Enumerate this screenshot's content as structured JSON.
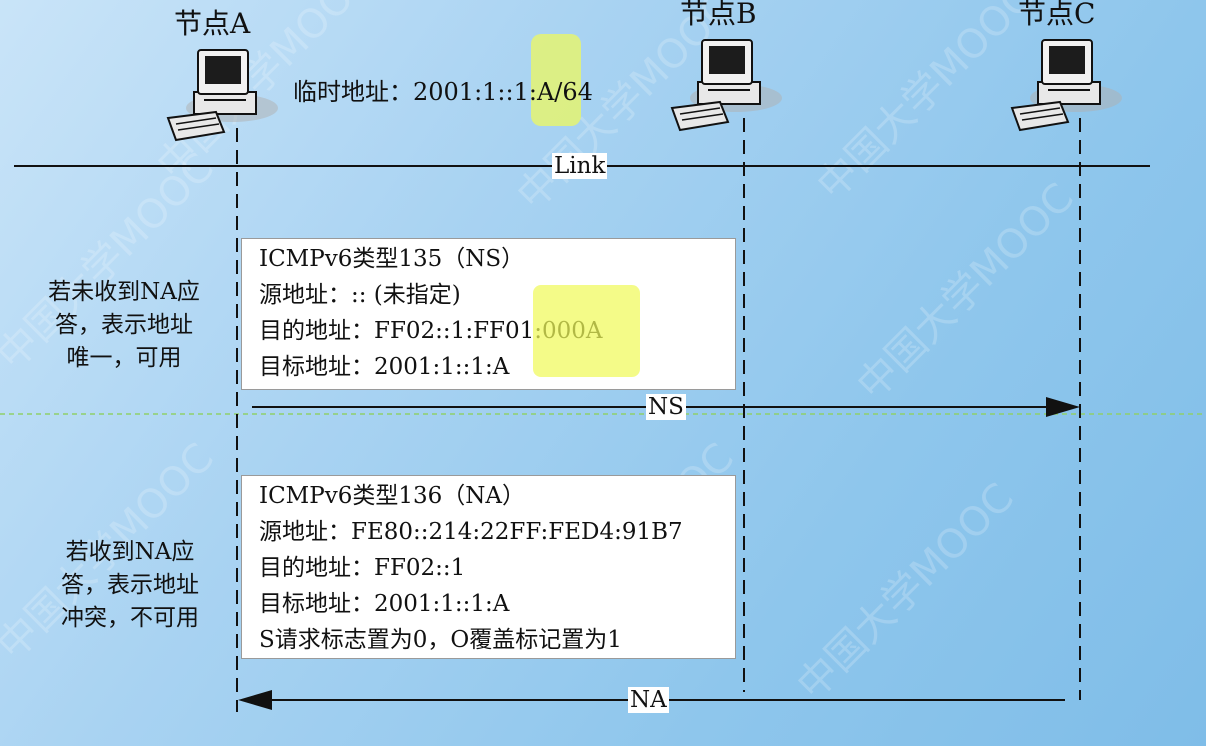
{
  "nodes": [
    {
      "label": "节点A"
    },
    {
      "label": "节点B"
    },
    {
      "label": "节点C"
    }
  ],
  "temp_address": "临时地址：2001:1::1:A/64",
  "link_label": "Link",
  "ns_box": {
    "lines": [
      "ICMPv6类型135（NS）",
      "源地址：:: (未指定)",
      "目的地址：FF02::1:FF01:000A",
      "目标地址：2001:1::1:A"
    ]
  },
  "na_box": {
    "lines": [
      "ICMPv6类型136（NA）",
      "源地址：FE80::214:22FF:FED4:91B7",
      "目的地址：FF02::1",
      "目标地址：2001:1::1:A",
      "S请求标志置为0，O覆盖标记置为1"
    ]
  },
  "ns_arrow_label": "NS",
  "na_arrow_label": "NA",
  "side_notes": {
    "no_na": [
      "若未收到NA应",
      "答，表示地址",
      "唯一，可用"
    ],
    "got_na": [
      "若收到NA应",
      "答，表示地址",
      "冲突，不可用"
    ]
  },
  "watermark_text": "中国大学MOOC",
  "colors": {
    "highlight": "#f0fa5a",
    "divider": "#8fd06a",
    "line": "#111111"
  }
}
